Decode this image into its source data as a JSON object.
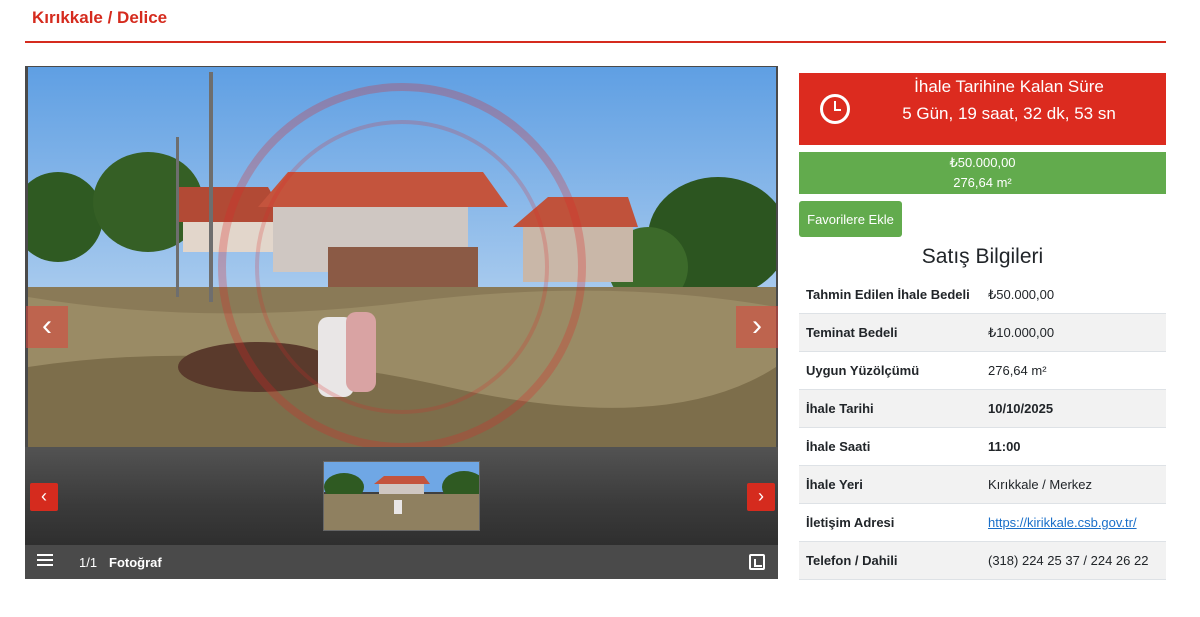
{
  "header": {
    "title": "Kırıkkale / Delice"
  },
  "gallery": {
    "prev_arrow": "‹",
    "next_arrow": "›",
    "counter": "1/1",
    "counter_label": "Fotoğraf"
  },
  "countdown": {
    "title": "İhale Tarihine Kalan Süre",
    "time": "5 Gün, 19 saat, 32 dk, 53 sn"
  },
  "price": {
    "amount": "₺50.000,00",
    "area": "276,64 m²"
  },
  "favorite_button": "Favorilere Ekle",
  "sales_info": {
    "title": "Satış Bilgileri",
    "rows": [
      {
        "label": "Tahmin Edilen İhale Bedeli",
        "value": "₺50.000,00"
      },
      {
        "label": "Teminat Bedeli",
        "value": "₺10.000,00"
      },
      {
        "label": "Uygun Yüzölçümü",
        "value": "276,64 m²"
      },
      {
        "label": "İhale Tarihi",
        "value": "10/10/2025"
      },
      {
        "label": "İhale Saati",
        "value": "11:00"
      },
      {
        "label": "İhale Yeri",
        "value": "Kırıkkale / Merkez"
      },
      {
        "label": "İletişim Adresi",
        "value": "https://kirikkale.csb.gov.tr/"
      },
      {
        "label": "Telefon / Dahili",
        "value": "(318) 224 25 37 / 224 26 22"
      }
    ]
  },
  "colors": {
    "brand_red": "#d52b1e",
    "countdown_red": "#dc2b1f",
    "green": "#62ab4d",
    "link": "#1a6fc9"
  },
  "icons": [
    "clock-icon",
    "list-icon",
    "expand-icon",
    "chevron-left-icon",
    "chevron-right-icon"
  ]
}
